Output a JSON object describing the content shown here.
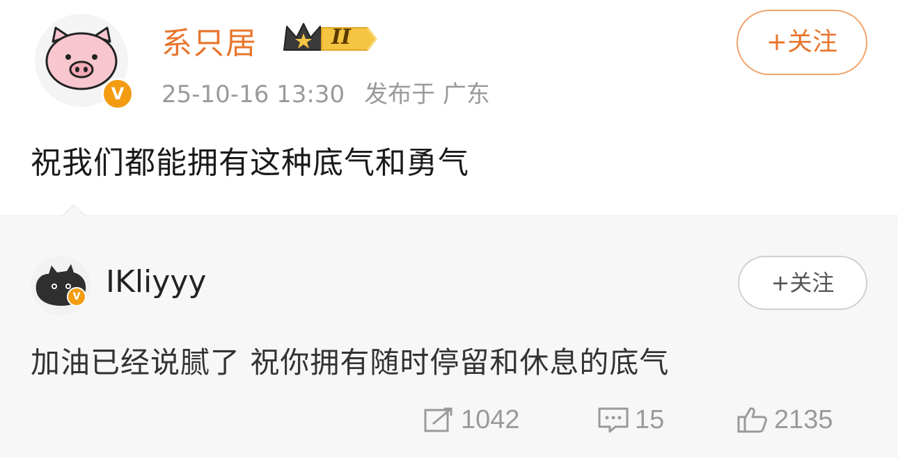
{
  "post": {
    "author": "系只居",
    "vip_level": "II",
    "date": "25-10-16 13:30",
    "published_at": "发布于 广东",
    "follow_label": "+关注",
    "text": "祝我们都能拥有这种底气和勇气",
    "verified_mark": "V"
  },
  "repost": {
    "author": "IKliyyy",
    "follow_label": "+关注",
    "text": "加油已经说腻了 祝你拥有随时停留和休息的底气",
    "verified_mark": "V"
  },
  "actions": {
    "reposts": "1042",
    "comments": "15",
    "likes": "2135"
  },
  "colors": {
    "accent": "#e8752c",
    "verified": "#f39c12",
    "muted": "#9a9a9a"
  },
  "icons": [
    "pig-avatar",
    "crown-icon",
    "verified-icon",
    "cat-avatar",
    "repost-icon",
    "comment-icon",
    "like-icon"
  ]
}
